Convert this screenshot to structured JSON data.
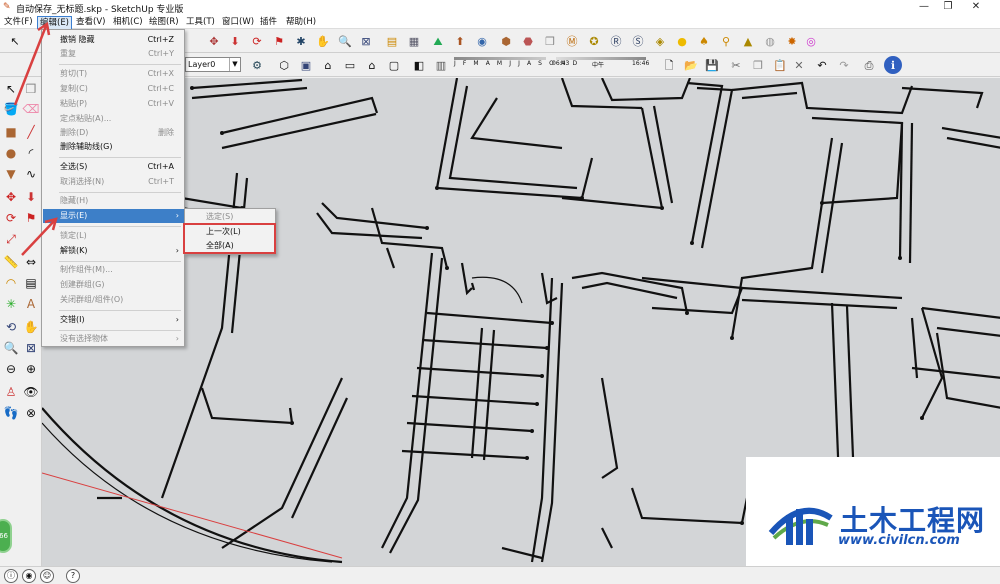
{
  "window": {
    "title": "自动保存_无标题.skp - SketchUp 专业版",
    "controls": [
      "—",
      "❐",
      "✕"
    ]
  },
  "menubar": {
    "items": [
      "文件(F)",
      "编辑(E)",
      "查看(V)",
      "相机(C)",
      "绘图(R)",
      "工具(T)",
      "窗口(W)",
      "插件",
      "帮助(H)"
    ]
  },
  "toolbar": {
    "layer_value": "Layer0",
    "months": "J F M A M J J A S O N D",
    "time_start": "06:43",
    "time_mid": "中午",
    "time_end": "16:46"
  },
  "edit_menu": {
    "items": [
      {
        "label": "撤销 隐藏",
        "shortcut": "Ctrl+Z",
        "disabled": false
      },
      {
        "label": "重复",
        "shortcut": "Ctrl+Y",
        "disabled": true
      },
      {
        "label": "剪切(T)",
        "shortcut": "Ctrl+X",
        "disabled": true
      },
      {
        "label": "复制(C)",
        "shortcut": "Ctrl+C",
        "disabled": true
      },
      {
        "label": "粘贴(P)",
        "shortcut": "Ctrl+V",
        "disabled": true
      },
      {
        "label": "定点粘贴(A)...",
        "shortcut": "",
        "disabled": true
      },
      {
        "label": "删除(D)",
        "shortcut": "删除",
        "disabled": true
      },
      {
        "label": "删除辅助线(G)",
        "shortcut": "",
        "disabled": false
      },
      {
        "label": "全选(S)",
        "shortcut": "Ctrl+A",
        "disabled": false
      },
      {
        "label": "取消选择(N)",
        "shortcut": "Ctrl+T",
        "disabled": true
      },
      {
        "label": "隐藏(H)",
        "shortcut": "",
        "disabled": true
      },
      {
        "label": "显示(E)",
        "shortcut": "",
        "disabled": false
      },
      {
        "label": "锁定(L)",
        "shortcut": "",
        "disabled": true
      },
      {
        "label": "解锁(K)",
        "shortcut": "",
        "disabled": false
      },
      {
        "label": "制作组件(M)...",
        "shortcut": "",
        "disabled": true
      },
      {
        "label": "创建群组(G)",
        "shortcut": "",
        "disabled": true
      },
      {
        "label": "关闭群组/组件(O)",
        "shortcut": "",
        "disabled": true
      },
      {
        "label": "交错(I)",
        "shortcut": "",
        "disabled": false
      },
      {
        "label": "没有选择物体",
        "shortcut": "",
        "disabled": true
      }
    ]
  },
  "show_submenu": {
    "items": [
      {
        "label": "选定(S)",
        "disabled": true
      },
      {
        "label": "上一次(L)",
        "disabled": false
      },
      {
        "label": "全部(A)",
        "disabled": false
      }
    ]
  },
  "left_badge": "66",
  "watermark": {
    "name": "土木工程网",
    "url": "www.civilcn.com"
  },
  "colors": {
    "canvas": "#d3d5d7",
    "menu_highlight": "#3d7fc8",
    "annotation_red": "#d94040",
    "watermark_blue": "#1a55b8"
  }
}
